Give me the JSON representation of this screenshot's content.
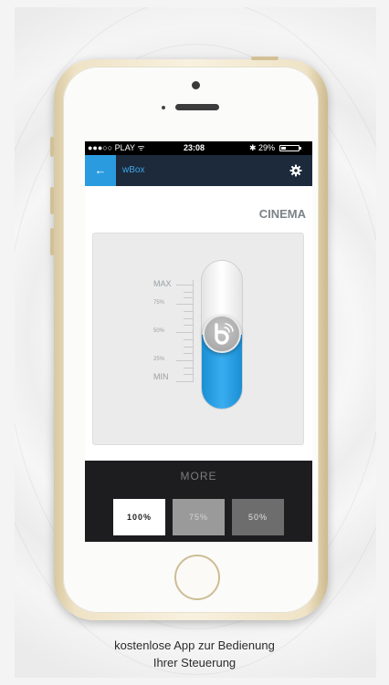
{
  "status_bar": {
    "carrier": "●●●○○ PLAY ᯤ",
    "time": "23:08",
    "bluetooth": "✱",
    "battery_percent": "29%",
    "battery_level": 0.29
  },
  "nav": {
    "back_icon": "←",
    "title": "wBox",
    "settings_icon": "gear-icon"
  },
  "scene_title": "CINEMA",
  "scale": {
    "max": "MAX",
    "p75": "75%",
    "p50": "50%",
    "p25": "25%",
    "min": "MIN"
  },
  "slider": {
    "level": 0.5
  },
  "more": {
    "label": "MORE",
    "presets": [
      "100%",
      "75%",
      "50%"
    ]
  },
  "caption": {
    "line1": "kostenlose App zur Bedienung",
    "line2": "Ihrer Steuerung"
  },
  "colors": {
    "accent": "#2b9be0",
    "navbar": "#1c2a3c",
    "more_bg": "#1d1d1f"
  }
}
